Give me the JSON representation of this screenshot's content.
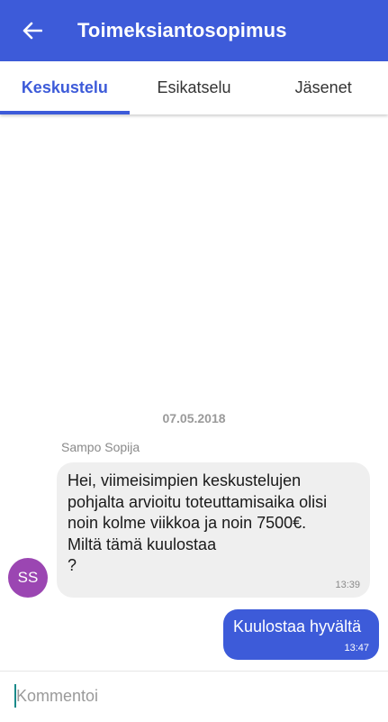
{
  "header": {
    "title": "Toimeksiantosopimus",
    "back_icon": "arrow-left-icon"
  },
  "tabs": [
    {
      "label": "Keskustelu",
      "active": true
    },
    {
      "label": "Esikatselu",
      "active": false
    },
    {
      "label": "Jäsenet",
      "active": false
    }
  ],
  "chat": {
    "date": "07.05.2018",
    "messages": [
      {
        "direction": "incoming",
        "sender": "Sampo Sopija",
        "avatar_initials": "SS",
        "text": "Hei, viimeisimpien keskustelujen\npohjalta arvioitu toteuttamisaika olisi\nnoin kolme viikkoa ja noin 7500€.\nMiltä tämä kuulostaa\n?",
        "time": "13:39"
      },
      {
        "direction": "outgoing",
        "text": "Kuulostaa hyvältä",
        "time": "13:47"
      }
    ]
  },
  "composer": {
    "placeholder": "Kommentoi",
    "value": ""
  },
  "colors": {
    "primary": "#3d5bd9",
    "avatar": "#9b46b2",
    "incoming_bubble": "#efefef"
  }
}
